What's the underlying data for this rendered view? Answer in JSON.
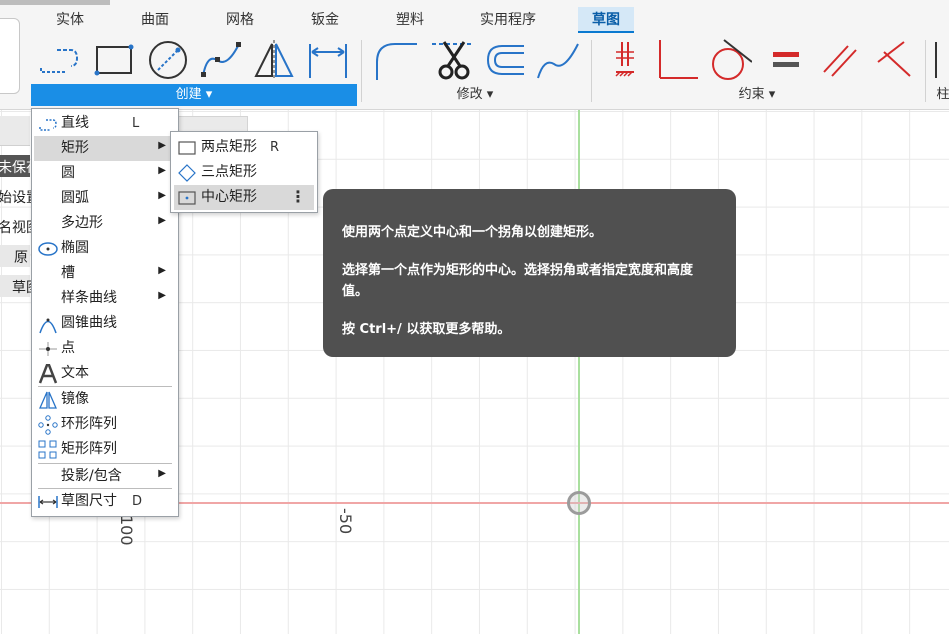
{
  "tabs": [
    {
      "label": "实体"
    },
    {
      "label": "曲面"
    },
    {
      "label": "网格"
    },
    {
      "label": "钣金"
    },
    {
      "label": "塑料"
    },
    {
      "label": "实用程序"
    },
    {
      "label": "草图",
      "active": true
    }
  ],
  "groups": {
    "create": "创建 ▾",
    "modify": "修改 ▾",
    "constraints": "约束 ▾",
    "cut_label": "柱"
  },
  "toolbar_icons": {
    "create": [
      "line-icon",
      "rectangle-icon",
      "circle-icon",
      "spline-icon",
      "mirror-icon",
      "dimension-icon"
    ],
    "modify": [
      "fillet-icon",
      "trim-icon",
      "offset-icon",
      "extend-icon"
    ],
    "constraints": [
      "horizontal-vertical-icon",
      "perpendicular-icon",
      "tangent-icon",
      "equal-icon",
      "parallel-icon",
      "coincident-icon"
    ]
  },
  "side_panel": {
    "items": [
      "未保存",
      "始设置",
      "名视图",
      "原",
      "草图"
    ]
  },
  "create_menu": {
    "items": [
      {
        "label": "直线",
        "shortcut": "L",
        "icon": "line-icon"
      },
      {
        "label": "矩形",
        "submenu": true,
        "highlight": true
      },
      {
        "label": "圆",
        "submenu": true
      },
      {
        "label": "圆弧",
        "submenu": true
      },
      {
        "label": "多边形",
        "submenu": true
      },
      {
        "label": "椭圆",
        "icon": "ellipse-icon"
      },
      {
        "label": "槽",
        "submenu": true
      },
      {
        "label": "样条曲线",
        "submenu": true
      },
      {
        "label": "圆锥曲线",
        "icon": "conic-curve-icon"
      },
      {
        "label": "点",
        "icon": "point-icon"
      },
      {
        "label": "文本",
        "icon": "text-icon"
      },
      {
        "label": "镜像",
        "icon": "mirror-icon"
      },
      {
        "label": "环形阵列",
        "icon": "circular-pattern-icon"
      },
      {
        "label": "矩形阵列",
        "icon": "rectangular-pattern-icon"
      },
      {
        "label": "投影/包含",
        "submenu": true
      },
      {
        "label": "草图尺寸",
        "shortcut": "D",
        "icon": "sketch-dimension-icon"
      }
    ]
  },
  "rect_submenu": {
    "items": [
      {
        "label": "两点矩形",
        "shortcut": "R",
        "icon": "two-point-rectangle-icon"
      },
      {
        "label": "三点矩形",
        "icon": "three-point-rectangle-icon"
      },
      {
        "label": "中心矩形",
        "icon": "center-rectangle-icon",
        "highlight": true,
        "more": "⋮"
      }
    ]
  },
  "tooltip": {
    "line1": "使用两个点定义中心和一个拐角以创建矩形。",
    "line2": "选择第一个点作为矩形的中心。选择拐角或者指定宽度和高度值。",
    "line3": "按 Ctrl+/ 以获取更多帮助。"
  },
  "canvas": {
    "ruler_labels": [
      "100",
      "-50"
    ]
  },
  "colors": {
    "accent": "#1a8ee6",
    "constraint_red": "#d42a2a",
    "tool_blue": "#2874c8",
    "axis_x": "#f0a6a6",
    "axis_y": "#a9df9e"
  }
}
